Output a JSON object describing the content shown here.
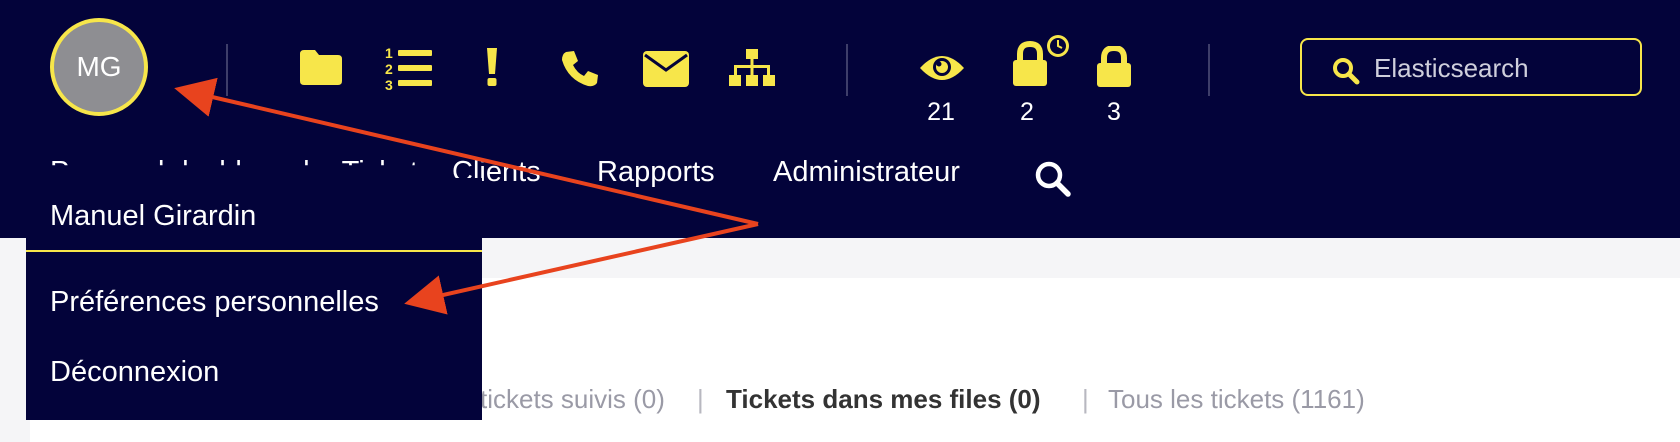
{
  "user": {
    "initials": "MG",
    "full_name": "Manuel Girardin"
  },
  "toolbar": {
    "icons": [
      "folder-icon",
      "numbered-list-icon",
      "exclamation-icon",
      "phone-icon",
      "envelope-icon",
      "sitemap-icon"
    ],
    "counters": [
      {
        "icon": "eye-icon",
        "count": "21"
      },
      {
        "icon": "lock-clock-icon",
        "count": "2"
      },
      {
        "icon": "lock-icon",
        "count": "3"
      }
    ]
  },
  "search": {
    "placeholder": "Elasticsearch"
  },
  "nav": {
    "items": [
      "Personal dashboard",
      "Tickets",
      "Clients",
      "Rapports",
      "Administrateur"
    ],
    "partial_visible": "Clients"
  },
  "dropdown": {
    "items": [
      "Manuel Girardin",
      "Préférences personnelles",
      "Déconnexion"
    ]
  },
  "tabs": [
    {
      "label": "tickets suivis (0)",
      "active": false
    },
    {
      "label": "Tickets dans mes files (0)",
      "active": true
    },
    {
      "label": "Tous les tickets (1161)",
      "active": false
    }
  ],
  "colors": {
    "header_bg": "#03033a",
    "accent": "#f7e64a",
    "annotation_arrow": "#e8431e",
    "content_bg": "#ffffff"
  }
}
